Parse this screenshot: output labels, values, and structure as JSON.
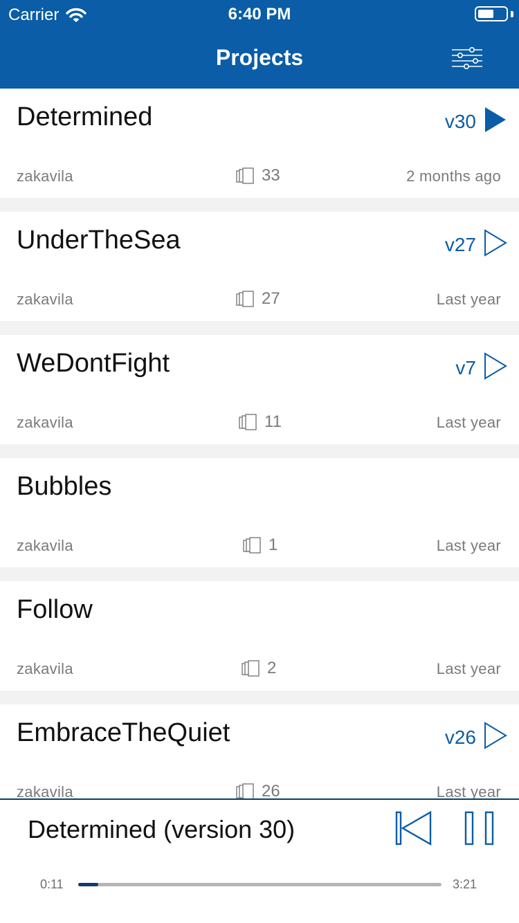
{
  "status_bar": {
    "carrier": "Carrier",
    "time": "6:40 PM"
  },
  "nav": {
    "title": "Projects",
    "filter_icon": "sliders-icon"
  },
  "projects": [
    {
      "title": "Determined",
      "owner": "zakavila",
      "count": "33",
      "time": "2 months ago",
      "version": "v30",
      "play_state": "playing"
    },
    {
      "title": "UnderTheSea",
      "owner": "zakavila",
      "count": "27",
      "time": "Last year",
      "version": "v27",
      "play_state": "idle"
    },
    {
      "title": "WeDontFight",
      "owner": "zakavila",
      "count": "11",
      "time": "Last year",
      "version": "v7",
      "play_state": "idle"
    },
    {
      "title": "Bubbles",
      "owner": "zakavila",
      "count": "1",
      "time": "Last year",
      "version": "",
      "play_state": "none"
    },
    {
      "title": "Follow",
      "owner": "zakavila",
      "count": "2",
      "time": "Last year",
      "version": "",
      "play_state": "none"
    },
    {
      "title": "EmbraceTheQuiet",
      "owner": "zakavila",
      "count": "26",
      "time": "Last year",
      "version": "v26",
      "play_state": "idle"
    }
  ],
  "player": {
    "now_playing": "Determined (version 30)",
    "elapsed": "0:11",
    "total": "3:21",
    "progress_fraction": 0.055
  },
  "colors": {
    "accent": "#0a5da6",
    "dark_accent": "#0a3d6b",
    "background": "#f2f2f2"
  }
}
